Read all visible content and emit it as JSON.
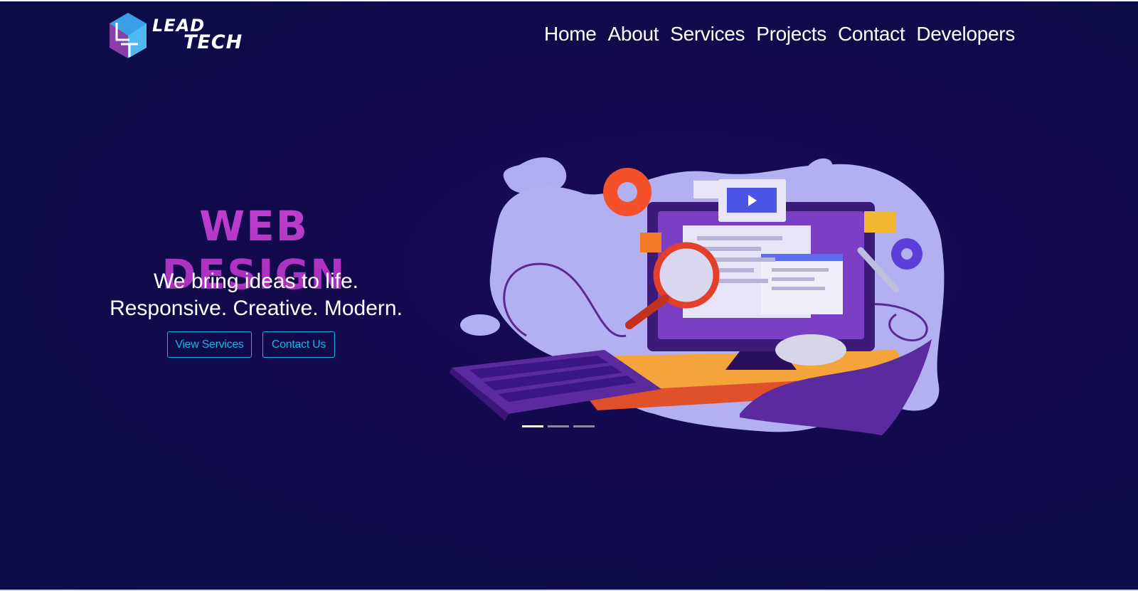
{
  "brand": {
    "logo_line1": "LEAD",
    "logo_line2": "TECH"
  },
  "nav": {
    "items": [
      {
        "label": "Home"
      },
      {
        "label": "About"
      },
      {
        "label": "Services"
      },
      {
        "label": "Projects"
      },
      {
        "label": "Contact"
      },
      {
        "label": "Developers"
      }
    ]
  },
  "hero": {
    "title": "WEB DESIGN",
    "subtitle_line1": "We bring ideas to life.",
    "subtitle_line2": "Responsive. Creative. Modern.",
    "primary_button": "View Services",
    "secondary_button": "Contact Us"
  },
  "carousel": {
    "slide_count": 3,
    "active_slide": 1
  },
  "colors": {
    "background": "#0a0d45",
    "title": "#b635c7",
    "button_accent": "#19b4e0",
    "nav_text": "#ffffff"
  },
  "icons": [
    "leadtech-logo-icon",
    "computer-illustration"
  ]
}
